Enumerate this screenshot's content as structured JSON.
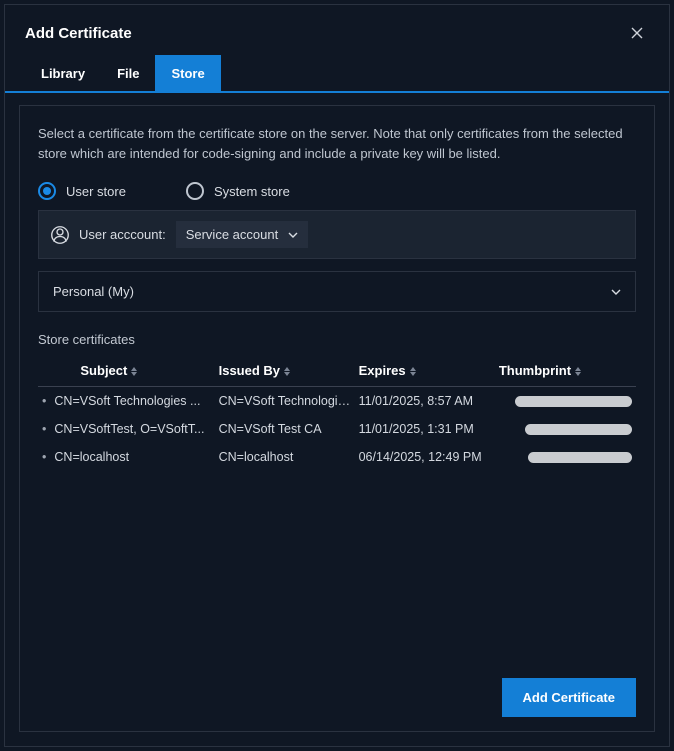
{
  "dialog": {
    "title": "Add Certificate",
    "tabs": {
      "library": "Library",
      "file": "File",
      "store": "Store"
    },
    "active_tab": "store"
  },
  "store_panel": {
    "description": "Select a certificate from the certificate store on the server. Note that only certificates from the selected store which are intended for code-signing and include a private key will be listed.",
    "radios": {
      "user": "User store",
      "system": "System store",
      "selected": "user"
    },
    "account_label": "User acccount:",
    "account_value": "Service account",
    "store_select_value": "Personal (My)",
    "section_label": "Store certificates"
  },
  "columns": {
    "subject": "Subject",
    "issued_by": "Issued By",
    "expires": "Expires",
    "thumbprint": "Thumbprint"
  },
  "rows": [
    {
      "subject": "CN=VSoft Technologies ...",
      "issued_by": "CN=VSoft Technologies ...",
      "expires": "11/01/2025, 8:57 AM",
      "thumbprint": "..."
    },
    {
      "subject": "CN=VSoftTest, O=VSoftT...",
      "issued_by": "CN=VSoft Test CA",
      "expires": "11/01/2025, 1:31 PM",
      "thumbprint": "..."
    },
    {
      "subject": "CN=localhost",
      "issued_by": "CN=localhost",
      "expires": "06/14/2025, 12:49 PM",
      "thumbprint": "..."
    }
  ],
  "footer": {
    "primary": "Add Certificate"
  }
}
